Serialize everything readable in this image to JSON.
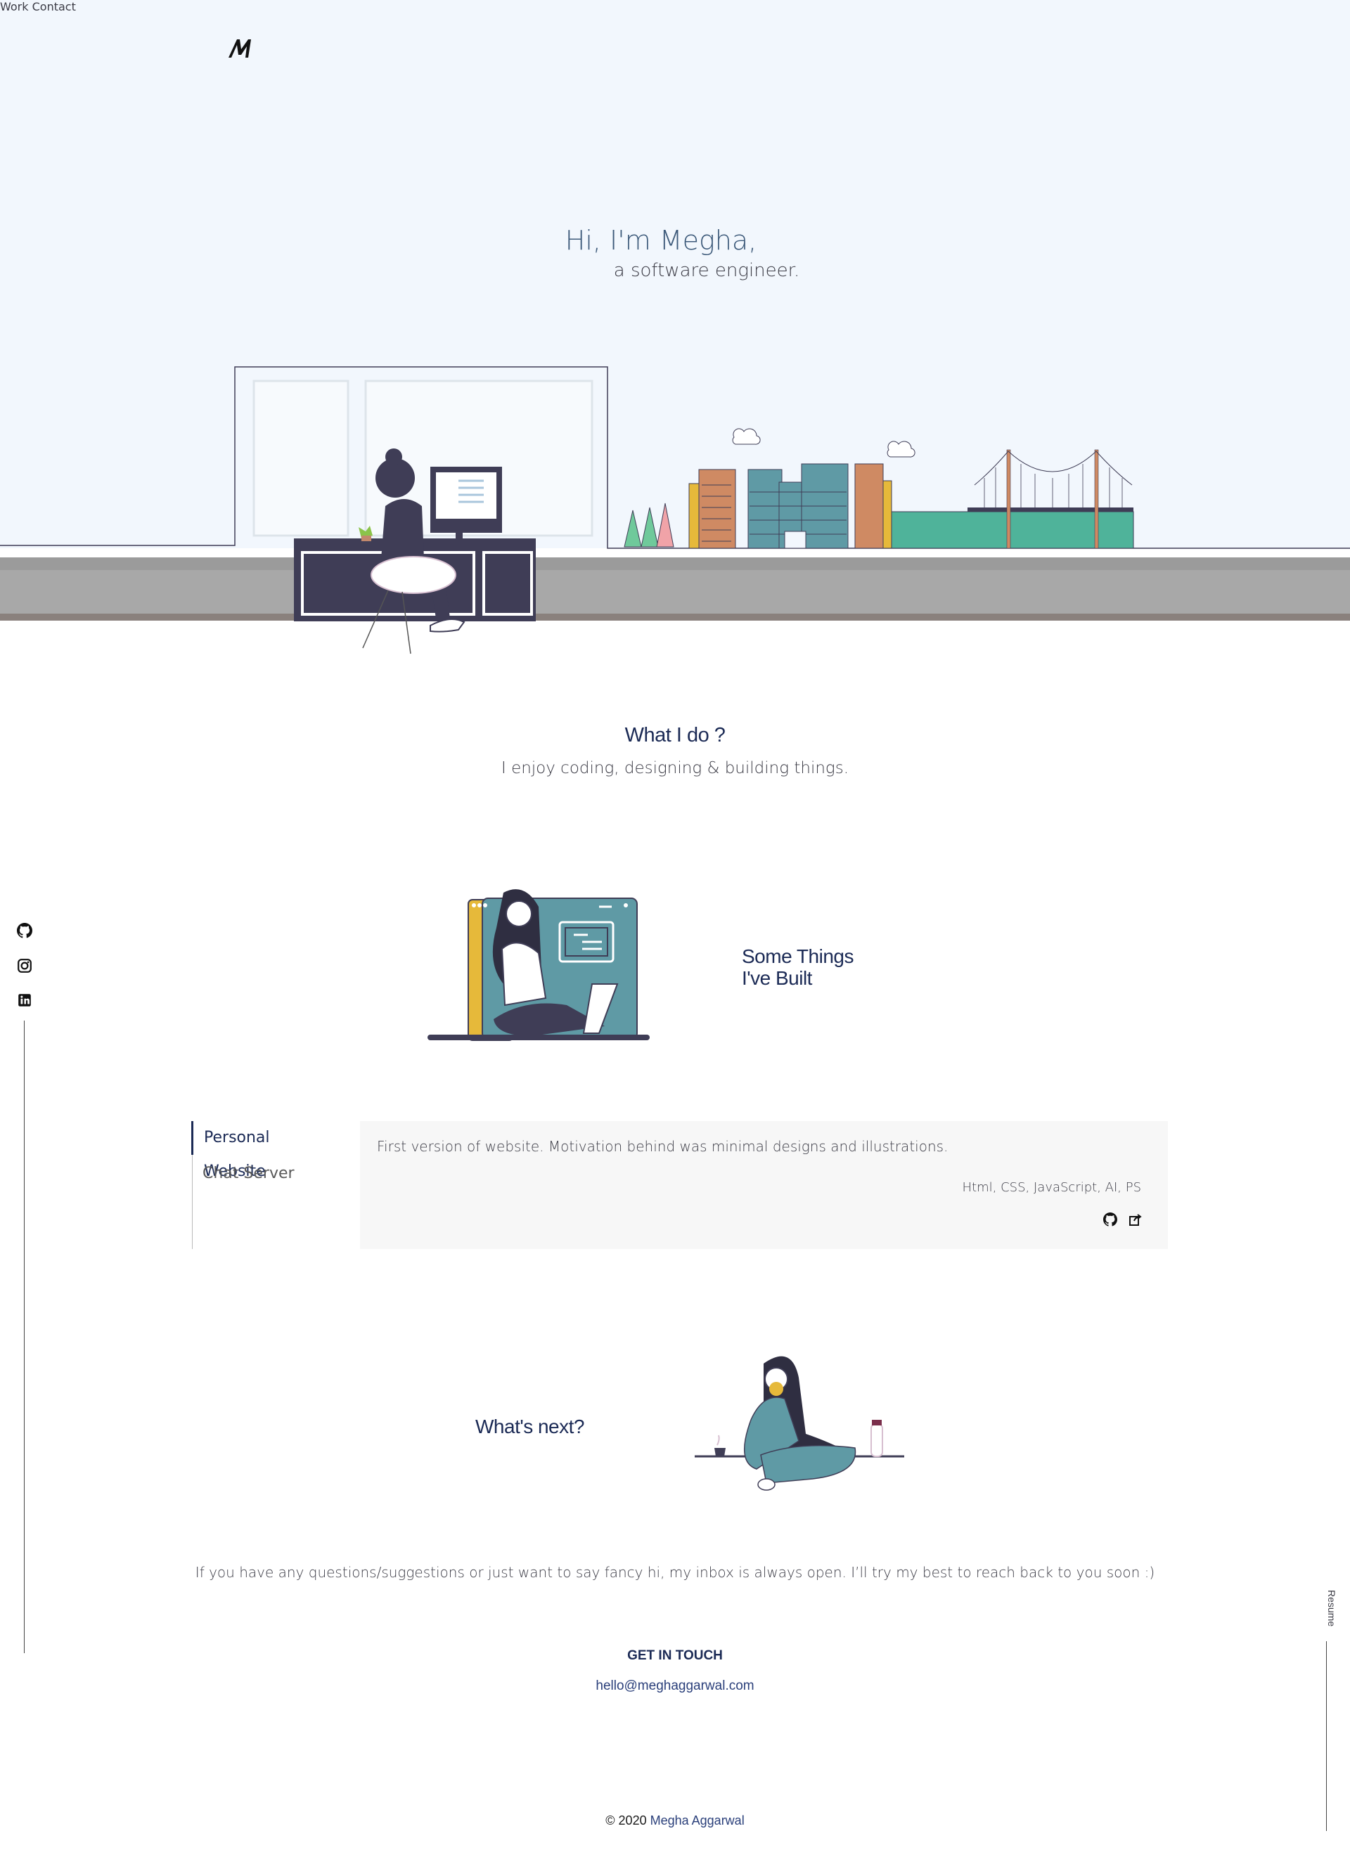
{
  "nav": {
    "work": "Work",
    "contact": "Contact"
  },
  "hero": {
    "greeting": "Hi, I'm Megha,",
    "role": "a software engineer."
  },
  "whatido": {
    "title": "What I do ?",
    "subtitle": "I enjoy coding, designing & building things."
  },
  "built": {
    "title_line1": "Some Things",
    "title_line2": "I've Built"
  },
  "projects": {
    "tabs": [
      "Personal Website",
      "Chat Server"
    ],
    "active": {
      "description": "First version of website. Motivation behind was minimal designs and illustrations.",
      "tech": "Html, CSS, JavaScript, AI, PS"
    }
  },
  "next": {
    "title": "What's next?"
  },
  "contact": {
    "message": "If you have any questions/suggestions or just want to say fancy hi, my inbox is always open. I’ll try my best to reach back to you soon :)",
    "cta": "GET IN TOUCH",
    "email": "hello@meghaggarwal.com"
  },
  "footer": {
    "copyright": "© 2020",
    "name": "Megha Aggarwal"
  },
  "sidebar": {
    "resume": "Resume"
  },
  "colors": {
    "navy": "#1b2a55",
    "teal": "#5f9aa5",
    "green": "#4fb39a",
    "ink": "#3f3d56",
    "mustard": "#e6b93a"
  }
}
